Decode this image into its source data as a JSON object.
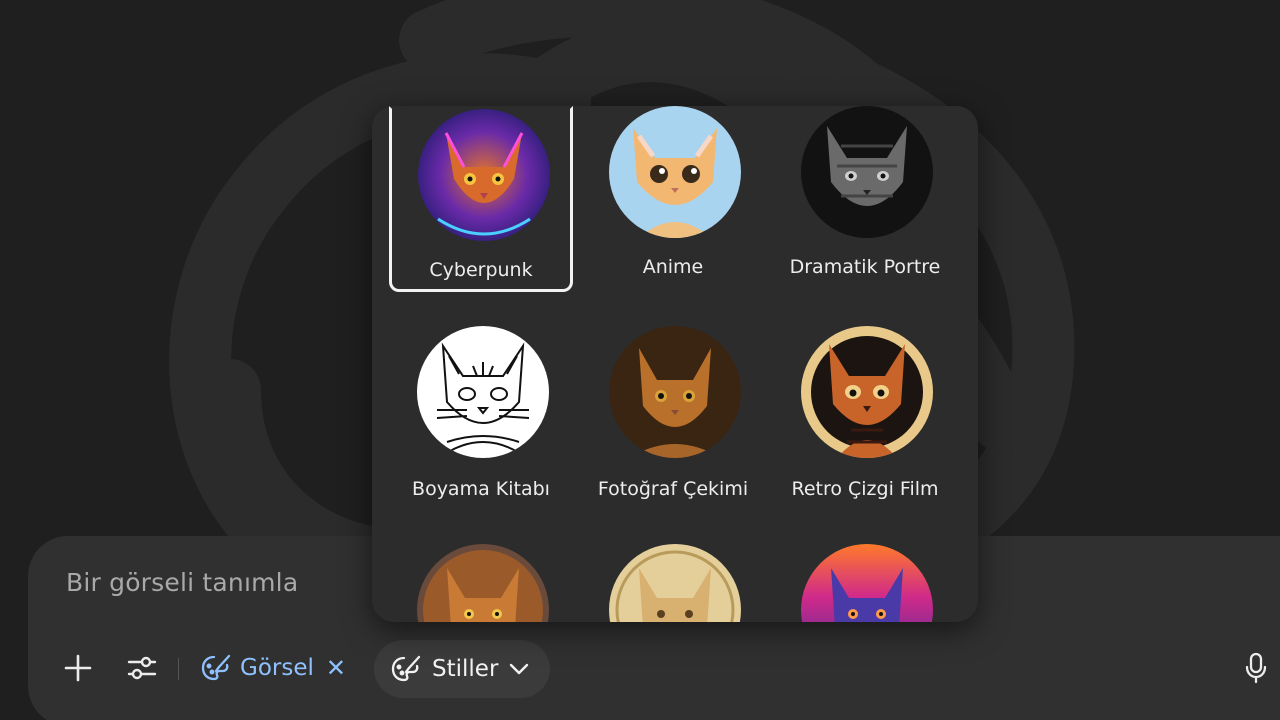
{
  "composer": {
    "prompt_placeholder": "Bir görseli tanımla",
    "image_chip_label": "Görsel",
    "styles_button_label": "Stiller"
  },
  "style_picker": {
    "selected": "Cyberpunk",
    "styles": [
      {
        "label": "Cyberpunk"
      },
      {
        "label": "Anime"
      },
      {
        "label": "Dramatik Portre"
      },
      {
        "label": "Boyama Kitabı"
      },
      {
        "label": "Fotoğraf Çekimi"
      },
      {
        "label": "Retro Çizgi Film"
      },
      {
        "label": ""
      },
      {
        "label": ""
      },
      {
        "label": ""
      }
    ]
  },
  "colors": {
    "background": "#1f1f1f",
    "composer": "#303030",
    "panel": "#2c2c2c",
    "accent_blue": "#8fc1ff"
  }
}
